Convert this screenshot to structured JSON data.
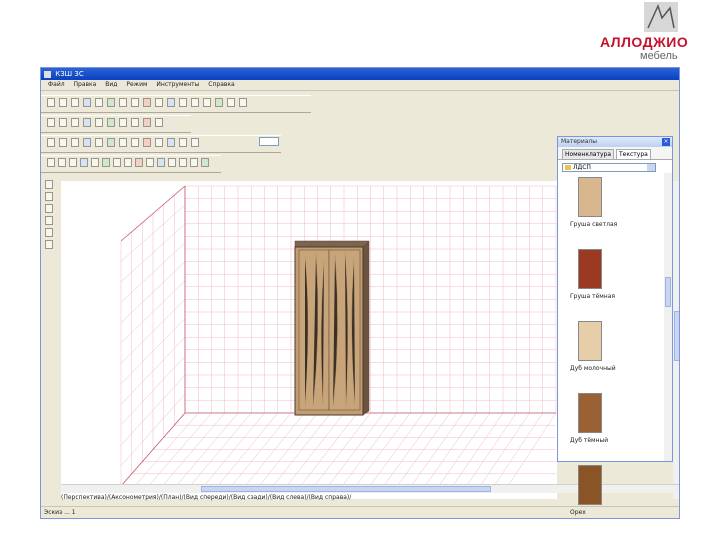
{
  "brand": {
    "logo_text": "АЛЛОДЖИО",
    "tagline": "мебель",
    "accent": "#c4122f"
  },
  "window": {
    "title": "К3Ш 3С",
    "menus": [
      "Файл",
      "Правка",
      "Вид",
      "Режим",
      "Инструменты",
      "Справка"
    ],
    "icons": {
      "toolbar1": [
        "new-icon",
        "open-icon",
        "save-icon",
        "print-icon",
        "cut-icon",
        "copy-icon",
        "paste-icon",
        "undo-icon",
        "redo-icon",
        "zoom-icon",
        "view-icon",
        "frame-icon",
        "frame-icon",
        "frame-icon",
        "frame-icon",
        "frame-icon",
        "arrow-icon"
      ],
      "toolbar2": [
        "grid-icon",
        "move-icon",
        "rotate-icon",
        "scale-icon",
        "align-icon",
        "snap-icon",
        "layer-icon",
        "light-icon",
        "camera-icon",
        "render-icon"
      ],
      "toolbar3": [
        "box-icon",
        "panel-icon",
        "door-icon",
        "shelf-icon",
        "drawer-icon",
        "handle-icon",
        "texture-icon",
        "material-icon",
        "camera-icon",
        "wardrobe-icon",
        "color-icon",
        "material-icon",
        "book-icon"
      ],
      "toolbar4": [
        "grid-icon",
        "line-icon",
        "rect-icon",
        "circle-icon",
        "measure-icon",
        "dim-icon",
        "text-icon",
        "snap-icon",
        "palette-icon",
        "hatch-icon",
        "color-icon",
        "paint-icon",
        "light-icon",
        "bulb-icon",
        "render-icon"
      ]
    },
    "view_tabs": "(Перспектива)/(Аксонометрия)/(План)/(Вид спереди)/(Вид сзади)/(Вид слева)/(Вид справа)/",
    "status": "Эскиз ... 1"
  },
  "materials_panel": {
    "title": "Материалы",
    "tabs": [
      "Номенклатура",
      "Текстура"
    ],
    "folder": "ЛДСП",
    "items": [
      {
        "label": "Груша светлая",
        "color": "#d8b78f"
      },
      {
        "label": "Груша тёмная",
        "color": "#9b3a22"
      },
      {
        "label": "Дуб молочный",
        "color": "#e6cfa8"
      },
      {
        "label": "Дуб тёмный",
        "color": "#9a6234"
      },
      {
        "label": "Орех",
        "color": "#8a5427"
      }
    ]
  }
}
